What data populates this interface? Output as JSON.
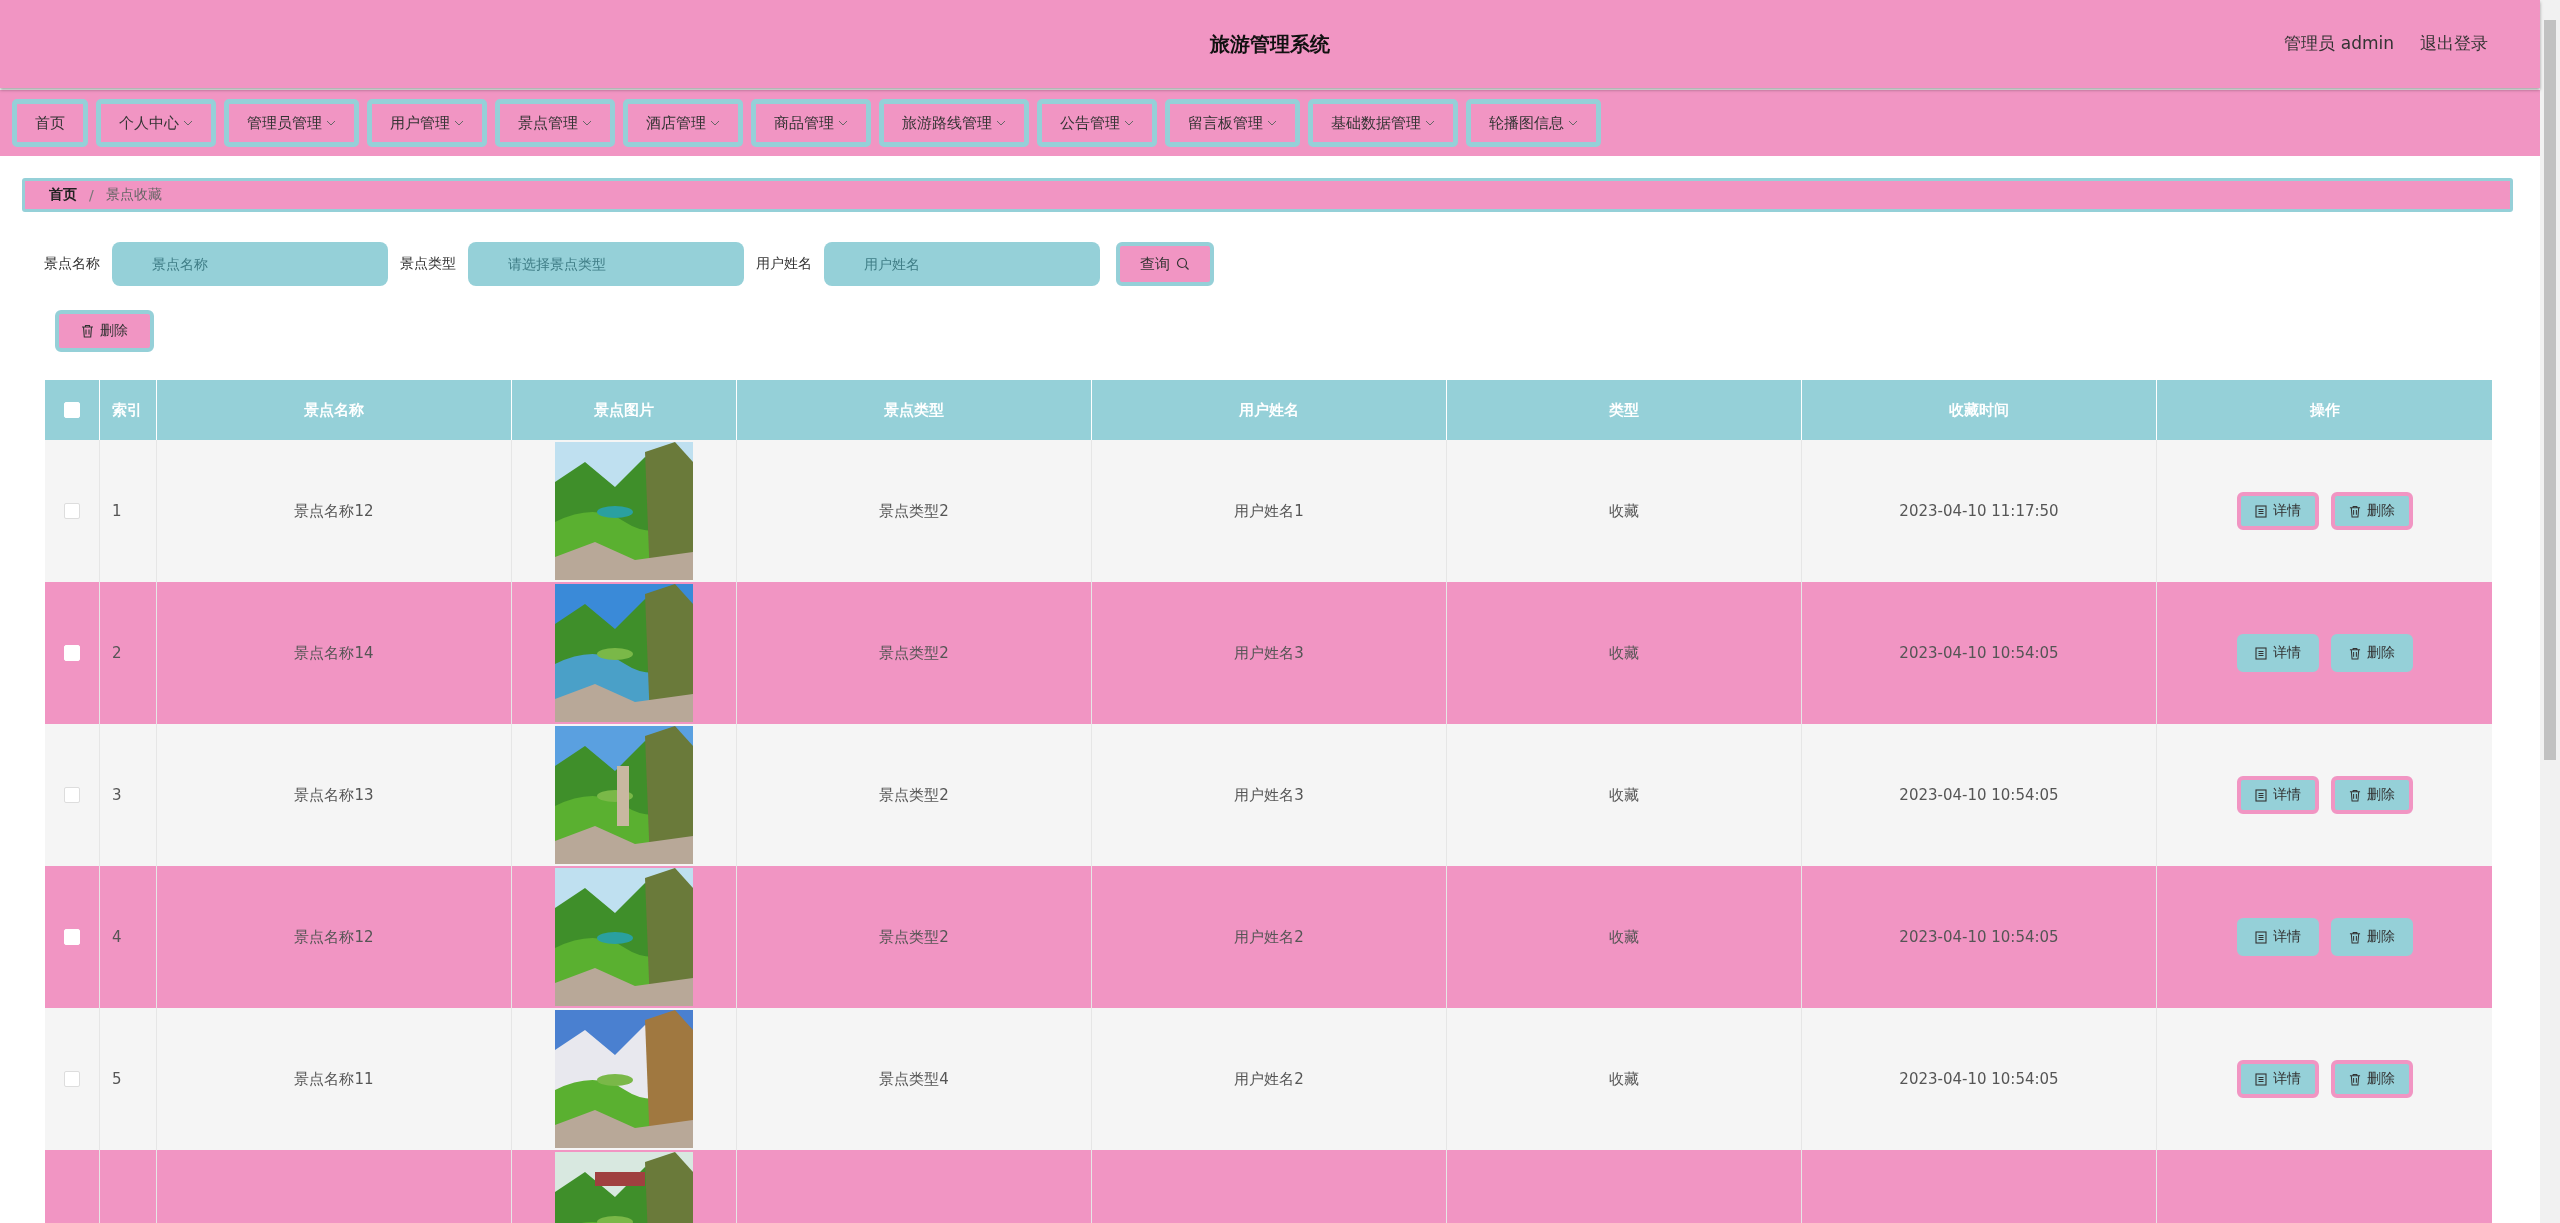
{
  "header": {
    "title": "旅游管理系统",
    "user": "管理员 admin",
    "logout": "退出登录"
  },
  "nav": [
    {
      "label": "首页",
      "dropdown": false
    },
    {
      "label": "个人中心",
      "dropdown": true
    },
    {
      "label": "管理员管理",
      "dropdown": true
    },
    {
      "label": "用户管理",
      "dropdown": true
    },
    {
      "label": "景点管理",
      "dropdown": true
    },
    {
      "label": "酒店管理",
      "dropdown": true
    },
    {
      "label": "商品管理",
      "dropdown": true
    },
    {
      "label": "旅游路线管理",
      "dropdown": true
    },
    {
      "label": "公告管理",
      "dropdown": true
    },
    {
      "label": "留言板管理",
      "dropdown": true
    },
    {
      "label": "基础数据管理",
      "dropdown": true
    },
    {
      "label": "轮播图信息",
      "dropdown": true
    }
  ],
  "breadcrumb": {
    "items": [
      "首页",
      "景点收藏"
    ],
    "separator": "/"
  },
  "search": {
    "fields": [
      {
        "label": "景点名称",
        "placeholder": "景点名称"
      },
      {
        "label": "景点类型",
        "placeholder": "请选择景点类型"
      },
      {
        "label": "用户姓名",
        "placeholder": "用户姓名"
      }
    ],
    "button": "查询"
  },
  "delete_button": "删除",
  "table": {
    "select_all": {
      "checked": false
    },
    "columns": [
      "索引",
      "景点名称",
      "景点图片",
      "景点类型",
      "用户姓名",
      "类型",
      "收藏时间",
      "操作"
    ],
    "rows": [
      {
        "checked": false,
        "index": "1",
        "name": "景点名称12",
        "image": {
          "kind": "picture"
        },
        "type": "景点类型2",
        "user": "用户姓名1",
        "fav_type": "收藏",
        "time": "2023-04-10 11:17:50",
        "actions": [
          "详情",
          "删除"
        ]
      },
      {
        "checked": false,
        "index": "2",
        "name": "景点名称14",
        "image": {
          "kind": "picture"
        },
        "type": "景点类型2",
        "user": "用户姓名3",
        "fav_type": "收藏",
        "time": "2023-04-10 10:54:05",
        "actions": [
          "详情",
          "删除"
        ]
      },
      {
        "checked": false,
        "index": "3",
        "name": "景点名称13",
        "image": {
          "kind": "picture"
        },
        "type": "景点类型2",
        "user": "用户姓名3",
        "fav_type": "收藏",
        "time": "2023-04-10 10:54:05",
        "actions": [
          "详情",
          "删除"
        ]
      },
      {
        "checked": false,
        "index": "4",
        "name": "景点名称12",
        "image": {
          "kind": "picture"
        },
        "type": "景点类型2",
        "user": "用户姓名2",
        "fav_type": "收藏",
        "time": "2023-04-10 10:54:05",
        "actions": [
          "详情",
          "删除"
        ]
      },
      {
        "checked": false,
        "index": "5",
        "name": "景点名称11",
        "image": {
          "kind": "picture"
        },
        "type": "景点类型4",
        "user": "用户姓名2",
        "fav_type": "收藏",
        "time": "2023-04-10 10:54:05",
        "actions": [
          "详情",
          "删除"
        ]
      },
      {
        "image": {
          "kind": "picture"
        }
      }
    ]
  }
}
